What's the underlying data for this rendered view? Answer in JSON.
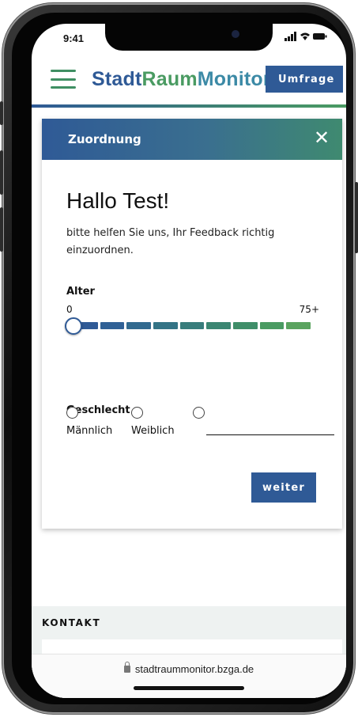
{
  "status_bar": {
    "time": "9:41",
    "icons": "signal wifi battery"
  },
  "header": {
    "logo_part1": "Stadt",
    "logo_part2": "Raum",
    "logo_part3": "Monitor",
    "survey_button": "Umfrage"
  },
  "modal": {
    "title": "Zuordnung",
    "close_symbol": "✕",
    "greeting": "Hallo Test!",
    "intro": "bitte helfen Sie uns, Ihr Feedback richtig einzuordnen.",
    "age": {
      "label": "Alter",
      "min_label": "0",
      "max_label": "75+",
      "value": 0,
      "segment_colors": [
        "#2f5a96",
        "#306196",
        "#326a8f",
        "#347486",
        "#387d7c",
        "#3b8672",
        "#3f8e69",
        "#4a9b62",
        "#5aa35f"
      ]
    },
    "gender": {
      "label": "Geschlecht",
      "options": [
        "Männlich",
        "Weiblich"
      ],
      "other_value": ""
    },
    "next_button": "weiter"
  },
  "footer": {
    "contact_title": "KONTAKT"
  },
  "browser": {
    "url": "stadtraummonitor.bzga.de"
  },
  "icons": {
    "menu": "hamburger-menu-icon",
    "close": "close-icon",
    "lock": "lock-icon"
  }
}
